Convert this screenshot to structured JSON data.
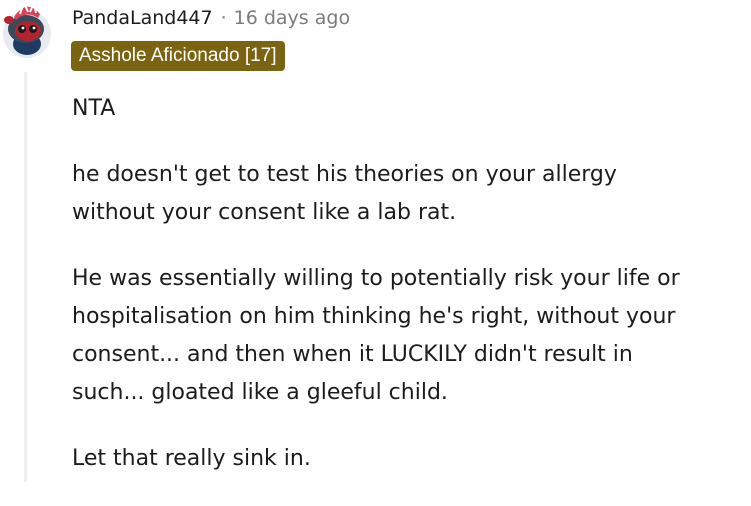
{
  "comment": {
    "username": "PandaLand447",
    "separator": "·",
    "timestamp": "16 days ago",
    "flair": "Asshole Aficionado [17]",
    "avatar_icon": "snoo-avatar-icon",
    "paragraphs": [
      {
        "lines": [
          "NTA"
        ]
      },
      {
        "lines": [
          "he doesn't get to test his theories on your allergy",
          "without your consent like a lab rat."
        ]
      },
      {
        "lines": [
          "He was essentially willing to potentially risk your life or",
          "hospitalisation on him thinking he's right, without your",
          "consent... and then when it LUCKILY didn't result in",
          "such... gloated like a gleeful child."
        ]
      },
      {
        "lines": [
          "Let that really sink in."
        ]
      }
    ]
  },
  "colors": {
    "flair_bg": "#7a6311",
    "flair_text": "#ffffff",
    "meta_gray": "#7c7c7c",
    "text": "#1c1c1c",
    "thread_line": "#edeff1"
  }
}
